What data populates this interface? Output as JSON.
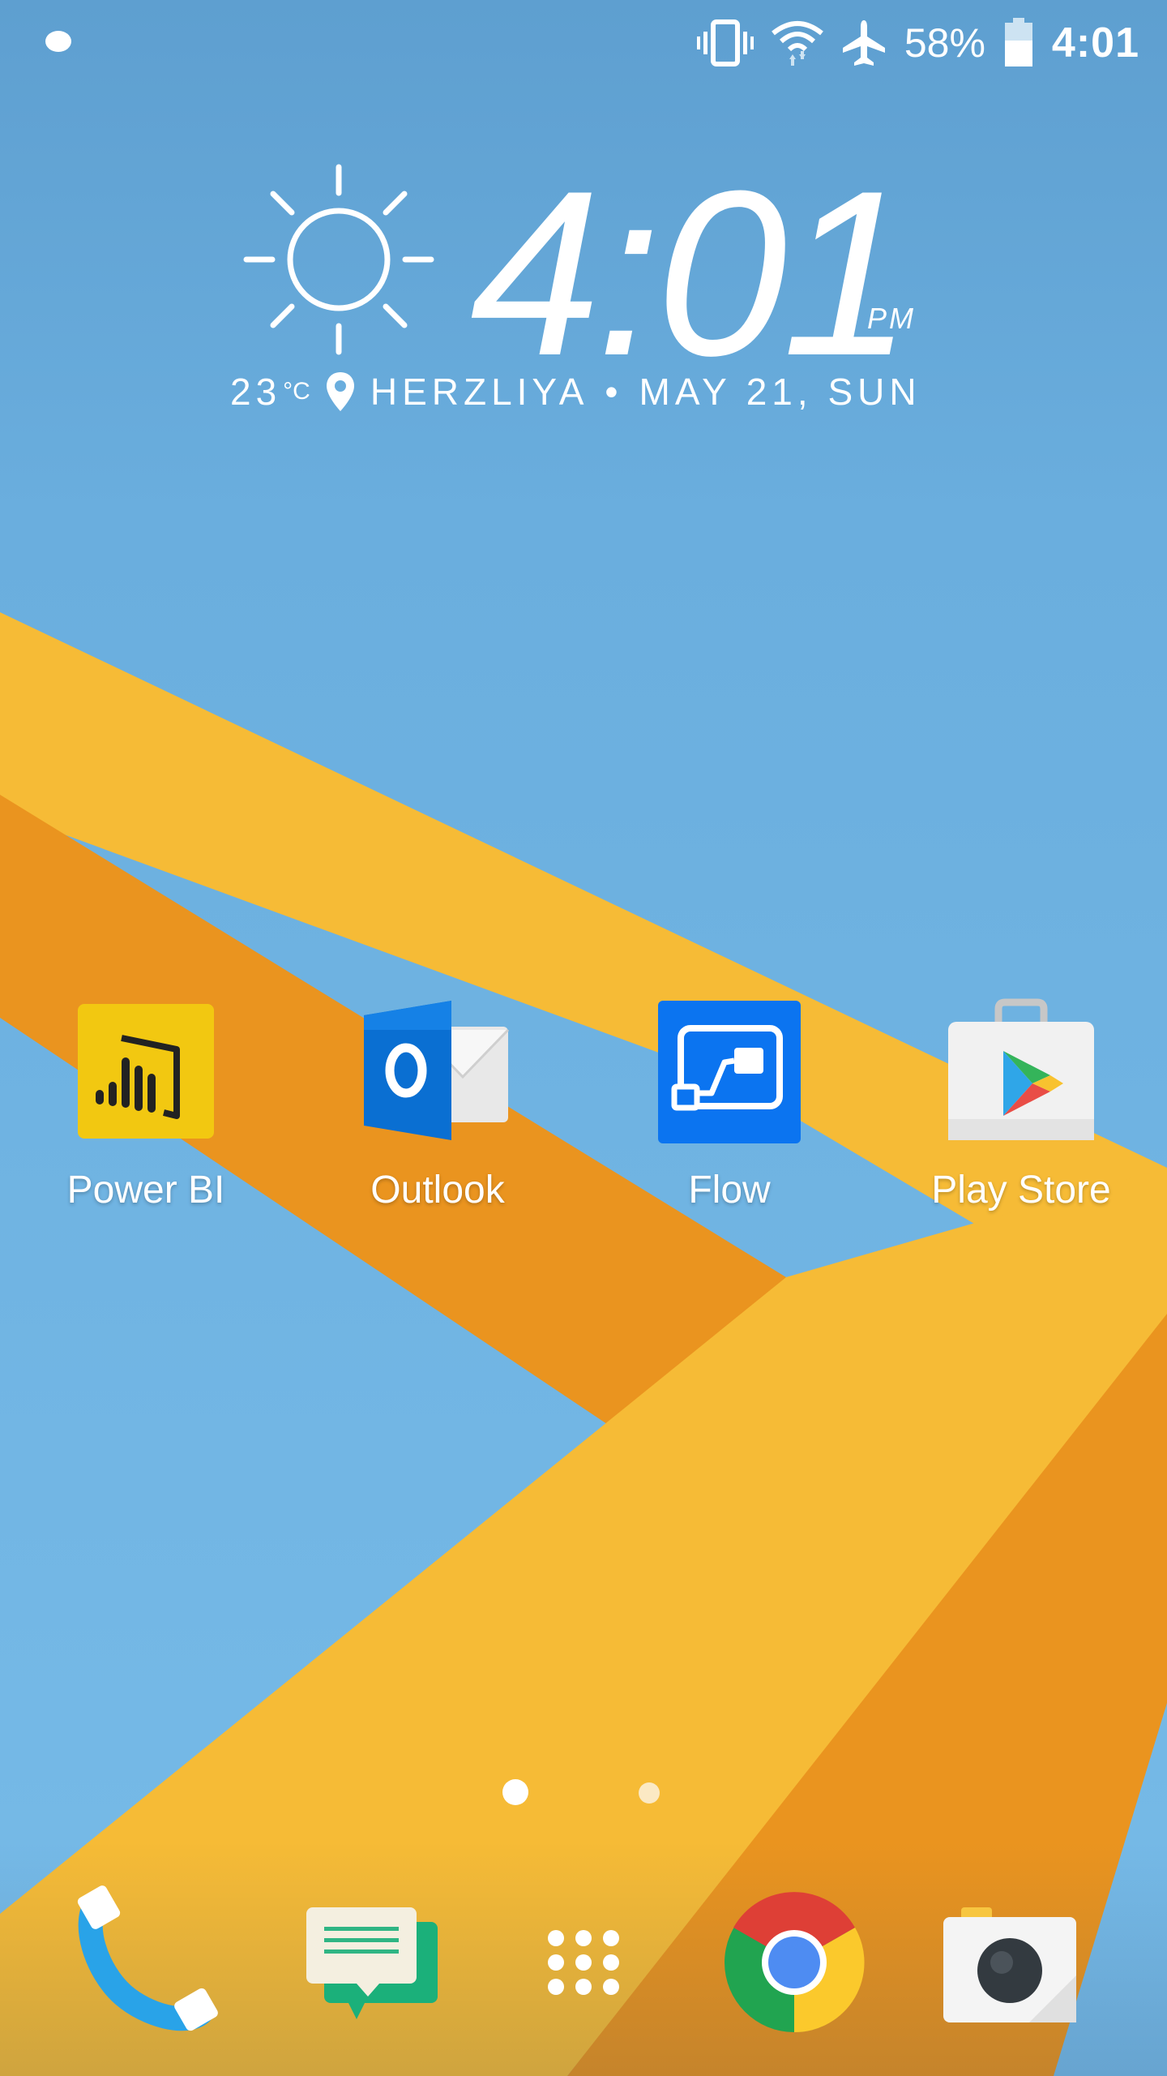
{
  "status_bar": {
    "battery_percent": "58%",
    "time": "4:01",
    "icons": [
      "notification-dot-icon",
      "vibrate-icon",
      "wifi-icon",
      "airplane-mode-icon",
      "battery-icon"
    ]
  },
  "clock_widget": {
    "time": "4:01",
    "ampm": "PM",
    "temperature": "23",
    "temperature_unit": "°C",
    "location": "HERZLIYA",
    "separator": "•",
    "date": "MAY 21, SUN",
    "weather_icon": "sun-icon"
  },
  "apps": [
    {
      "label": "Power BI",
      "icon": "power-bi-icon",
      "color": "#f2c811"
    },
    {
      "label": "Outlook",
      "icon": "outlook-icon",
      "color": "#0a6fd2"
    },
    {
      "label": "Flow",
      "icon": "flow-icon",
      "color": "#0b74f0"
    },
    {
      "label": "Play Store",
      "icon": "play-store-icon",
      "color": "#f1f1f1"
    }
  ],
  "page_indicator": {
    "total": 2,
    "current": 1
  },
  "dock": [
    {
      "name": "phone",
      "icon": "phone-icon"
    },
    {
      "name": "messages",
      "icon": "messages-icon"
    },
    {
      "name": "app-drawer",
      "icon": "app-drawer-icon"
    },
    {
      "name": "chrome",
      "icon": "chrome-icon"
    },
    {
      "name": "camera",
      "icon": "camera-icon"
    }
  ],
  "colors": {
    "sky": "#6aaede",
    "stripe_yellow": "#f6bb36",
    "stripe_orange": "#ea941f",
    "text": "#ffffff"
  }
}
